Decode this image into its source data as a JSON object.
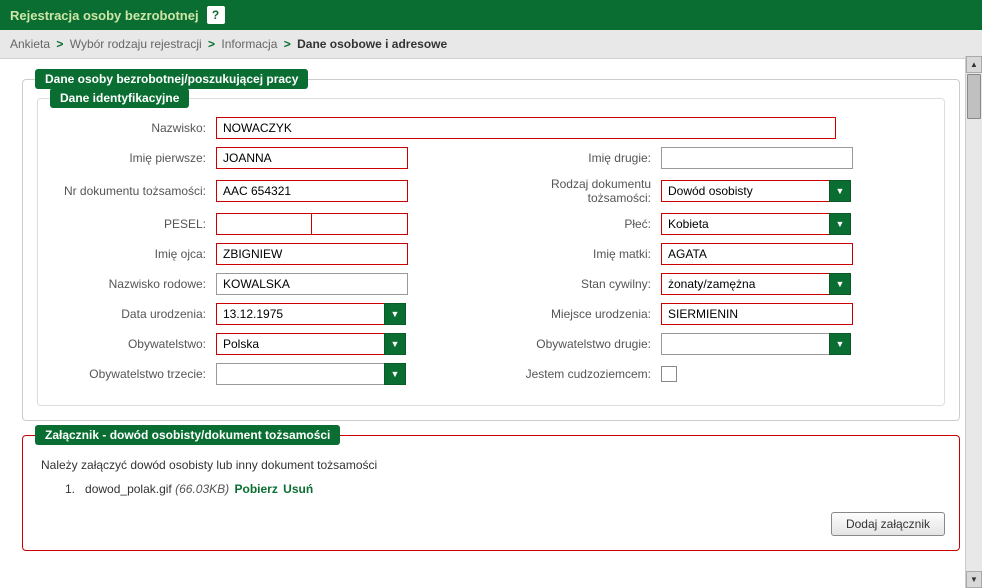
{
  "header": {
    "title": "Rejestracja osoby bezrobotnej",
    "help": "?"
  },
  "breadcrumb": {
    "items": [
      "Ankieta",
      "Wybór rodzaju rejestracji",
      "Informacja"
    ],
    "current": "Dane osobowe i adresowe",
    "sep": ">"
  },
  "section": {
    "main_legend": "Dane osoby bezrobotnej/poszukującej pracy",
    "ident_legend": "Dane identyfikacyjne"
  },
  "labels": {
    "nazwisko": "Nazwisko:",
    "imie_pierwsze": "Imię pierwsze:",
    "imie_drugie": "Imię drugie:",
    "nr_dok": "Nr dokumentu tożsamości:",
    "rodzaj_dok": "Rodzaj dokumentu tożsamości:",
    "pesel": "PESEL:",
    "plec": "Płeć:",
    "imie_ojca": "Imię ojca:",
    "imie_matki": "Imię matki:",
    "nazwisko_rodowe": "Nazwisko rodowe:",
    "stan_cywilny": "Stan cywilny:",
    "data_ur": "Data urodzenia:",
    "miejsce_ur": "Miejsce urodzenia:",
    "obywatelstwo": "Obywatelstwo:",
    "obywatelstwo2": "Obywatelstwo drugie:",
    "obywatelstwo3": "Obywatelstwo trzecie:",
    "cudzoziemiec": "Jestem cudzoziemcem:"
  },
  "values": {
    "nazwisko": "NOWACZYK",
    "imie_pierwsze": "JOANNA",
    "imie_drugie": "",
    "nr_dok": "AAC 654321",
    "rodzaj_dok": "Dowód osobisty",
    "pesel": "",
    "plec": "Kobieta",
    "imie_ojca": "ZBIGNIEW",
    "imie_matki": "AGATA",
    "nazwisko_rodowe": "KOWALSKA",
    "stan_cywilny": "żonaty/zamężna",
    "data_ur": "13.12.1975",
    "miejsce_ur": "SIERMIENIN",
    "obywatelstwo": "Polska",
    "obywatelstwo2": "",
    "obywatelstwo3": ""
  },
  "attachment": {
    "legend": "Załącznik - dowód osobisty/dokument tożsamości",
    "instruction": "Należy załączyć dowód osobisty lub inny dokument tożsamości",
    "items": [
      {
        "index": "1.",
        "name": "dowod_polak.gif",
        "size": "(66.03KB)",
        "download": "Pobierz",
        "remove": "Usuń"
      }
    ],
    "add_label": "Dodaj załącznik"
  },
  "icons": {
    "chevron_down": "▼",
    "arrow_up": "▲",
    "arrow_down": "▼"
  }
}
